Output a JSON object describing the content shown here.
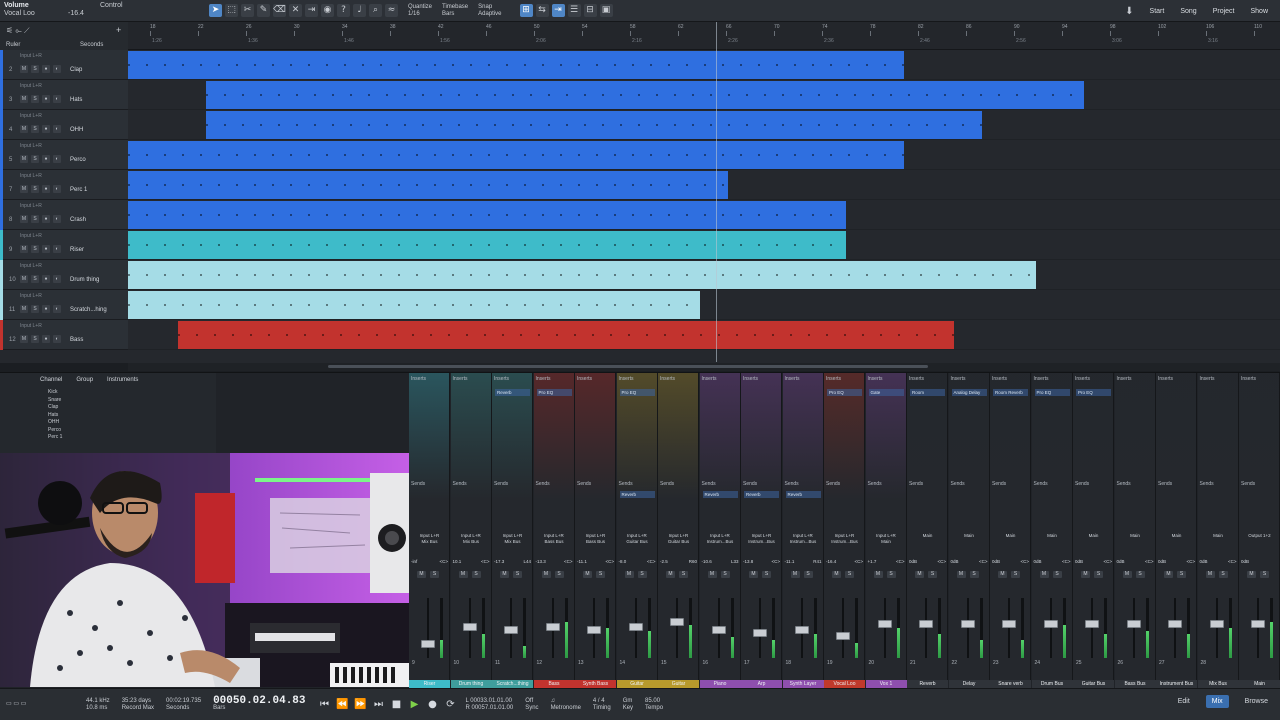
{
  "toolbar": {
    "inspector_param": "Volume",
    "inspector_track": "Vocal Loo",
    "inspector_value": "-16.4",
    "inspector_control": "Control",
    "quantize_label": "Quantize",
    "quantize_value": "1/16",
    "timebase_label": "Timebase",
    "timebase_value": "Bars",
    "snap_label": "Snap",
    "snap_value": "Adaptive",
    "start": "Start",
    "song": "Song",
    "project": "Project",
    "show": "Show"
  },
  "ruler": {
    "ruler_label": "Ruler",
    "seconds_label": "Seconds",
    "bar_ticks": [
      "18",
      "22",
      "26",
      "30",
      "34",
      "38",
      "42",
      "46",
      "50",
      "54",
      "58",
      "62",
      "66",
      "70",
      "74",
      "78",
      "82",
      "86",
      "90",
      "94",
      "98",
      "102",
      "106",
      "110"
    ],
    "time_ticks": [
      "1:26",
      "1:36",
      "1:46",
      "1:56",
      "2:06",
      "2:16",
      "2:26",
      "2:36",
      "2:46",
      "2:56",
      "3:06",
      "3:16"
    ]
  },
  "tracks": [
    {
      "num": "2",
      "name": "Clap",
      "input": "Input L+R",
      "color": "#2f6fe0"
    },
    {
      "num": "3",
      "name": "Hats",
      "input": "Input L+R",
      "color": "#2f6fe0"
    },
    {
      "num": "4",
      "name": "OHH",
      "input": "Input L+R",
      "color": "#2f6fe0"
    },
    {
      "num": "5",
      "name": "Perco",
      "input": "Input L+R",
      "color": "#2f6fe0"
    },
    {
      "num": "7",
      "name": "Perc 1",
      "input": "Input L+R",
      "color": "#2f6fe0"
    },
    {
      "num": "8",
      "name": "Crash",
      "input": "Input L+R",
      "color": "#2f6fe0"
    },
    {
      "num": "9",
      "name": "Riser",
      "input": "Input L+R",
      "color": "#3ebbc9"
    },
    {
      "num": "10",
      "name": "Drum thing",
      "input": "Input L+R",
      "color": "#a5dce6"
    },
    {
      "num": "11",
      "name": "Scratch...hing",
      "input": "Input L+R",
      "color": "#a5dce6"
    },
    {
      "num": "12",
      "name": "Bass",
      "input": "Input L+R",
      "color": "#c2332e"
    }
  ],
  "mixer": {
    "tabs": [
      "Channel",
      "Group",
      "Instruments"
    ],
    "list": [
      "Kick",
      "Snare",
      "Clap",
      "Hats",
      "OHH",
      "Perco",
      "Perc 1"
    ],
    "inserts_label": "Inserts",
    "sends_label": "Sends",
    "strips": [
      {
        "num": "9",
        "name": "Riser",
        "io": "Input L+R",
        "bus": "Mix Bus",
        "vol": "-inf",
        "pan": "<C>",
        "color": "#3ebbc9",
        "insert": "",
        "send": "",
        "level": 0.25,
        "meter": 0.3
      },
      {
        "num": "10",
        "name": "Drum thing",
        "io": "Input L+R",
        "bus": "Mix Bus",
        "vol": "10.1",
        "pan": "<C>",
        "color": "#3f9e9d",
        "insert": "",
        "send": "",
        "level": 0.55,
        "meter": 0.4
      },
      {
        "num": "11",
        "name": "Scratch...thing",
        "io": "Input L+R",
        "bus": "Mix Bus",
        "vol": "-17.3",
        "pan": "L44",
        "color": "#3f9e9d",
        "insert": "Reverb",
        "send": "",
        "level": 0.5,
        "meter": 0.2
      },
      {
        "num": "12",
        "name": "Bass",
        "io": "Input L+R",
        "bus": "Bass Bus",
        "vol": "-13.3",
        "pan": "<C>",
        "color": "#c2332e",
        "insert": "Pro EQ",
        "send": "",
        "level": 0.55,
        "meter": 0.6
      },
      {
        "num": "13",
        "name": "Synth Bass",
        "io": "Input L+R",
        "bus": "Bass Bus",
        "vol": "-11.1",
        "pan": "<C>",
        "color": "#c2332e",
        "insert": "",
        "send": "",
        "level": 0.5,
        "meter": 0.5
      },
      {
        "num": "14",
        "name": "Guitar",
        "io": "Input L+R",
        "bus": "Guitar Bus",
        "vol": "-8.0",
        "pan": "<C>",
        "color": "#b89a2c",
        "insert": "Pro EQ",
        "send": "Reverb",
        "level": 0.55,
        "meter": 0.45
      },
      {
        "num": "15",
        "name": "Guitar",
        "io": "Input L+R",
        "bus": "Guitar Bus",
        "vol": "-2.5",
        "pan": "R60",
        "color": "#b89a2c",
        "insert": "",
        "send": "",
        "level": 0.65,
        "meter": 0.55
      },
      {
        "num": "16",
        "name": "Piano",
        "io": "Input L+R",
        "bus": "Instrum...Bus",
        "vol": "-10.6",
        "pan": "L33",
        "color": "#8e4fae",
        "insert": "",
        "send": "Reverb",
        "level": 0.5,
        "meter": 0.35
      },
      {
        "num": "17",
        "name": "Arp",
        "io": "Input L+R",
        "bus": "Instrum...Bus",
        "vol": "-13.8",
        "pan": "<C>",
        "color": "#8e4fae",
        "insert": "",
        "send": "Reverb",
        "level": 0.45,
        "meter": 0.3
      },
      {
        "num": "18",
        "name": "Synth Layer",
        "io": "Input L+R",
        "bus": "Instrum...Bus",
        "vol": "-11.1",
        "pan": "R41",
        "color": "#8e4fae",
        "insert": "",
        "send": "Reverb",
        "level": 0.5,
        "meter": 0.4
      },
      {
        "num": "19",
        "name": "Vocal Loo",
        "io": "Input L+R",
        "bus": "Instrum...Bus",
        "vol": "-16.4",
        "pan": "<C>",
        "color": "#c0392b",
        "insert": "Pro EQ",
        "send": "",
        "level": 0.4,
        "meter": 0.25
      },
      {
        "num": "20",
        "name": "Vox 1",
        "io": "Input L+R",
        "bus": "Main",
        "vol": "+1.7",
        "pan": "<C>",
        "color": "#8e4fae",
        "insert": "Gate",
        "send": "",
        "level": 0.6,
        "meter": 0.5
      },
      {
        "num": "21",
        "name": "Reverb",
        "io": "",
        "bus": "Main",
        "vol": "0dB",
        "pan": "<C>",
        "color": "#2c3036",
        "insert": "Room",
        "send": "",
        "level": 0.6,
        "meter": 0.4
      },
      {
        "num": "22",
        "name": "Delay",
        "io": "",
        "bus": "Main",
        "vol": "0dB",
        "pan": "<C>",
        "color": "#2c3036",
        "insert": "Analog Delay",
        "send": "",
        "level": 0.6,
        "meter": 0.3
      },
      {
        "num": "23",
        "name": "Snare verb",
        "io": "",
        "bus": "Main",
        "vol": "0dB",
        "pan": "<C>",
        "color": "#2c3036",
        "insert": "Room Reverb",
        "send": "",
        "level": 0.6,
        "meter": 0.3
      },
      {
        "num": "24",
        "name": "Drum Bus",
        "io": "",
        "bus": "Main",
        "vol": "0dB",
        "pan": "<C>",
        "color": "#2c3036",
        "insert": "Pro EQ",
        "send": "",
        "level": 0.6,
        "meter": 0.55
      },
      {
        "num": "25",
        "name": "Guitar Bus",
        "io": "",
        "bus": "Main",
        "vol": "0dB",
        "pan": "<C>",
        "color": "#2c3036",
        "insert": "Pro EQ",
        "send": "",
        "level": 0.6,
        "meter": 0.4
      },
      {
        "num": "26",
        "name": "Bass Bus",
        "io": "",
        "bus": "Main",
        "vol": "0dB",
        "pan": "<C>",
        "color": "#2c3036",
        "insert": "",
        "send": "",
        "level": 0.6,
        "meter": 0.45
      },
      {
        "num": "27",
        "name": "Instrument Bus",
        "io": "",
        "bus": "Main",
        "vol": "0dB",
        "pan": "<C>",
        "color": "#2c3036",
        "insert": "",
        "send": "",
        "level": 0.6,
        "meter": 0.4
      },
      {
        "num": "28",
        "name": "Mix Bus",
        "io": "",
        "bus": "Main",
        "vol": "0dB",
        "pan": "<C>",
        "color": "#2c3036",
        "insert": "",
        "send": "",
        "level": 0.6,
        "meter": 0.5
      },
      {
        "num": "",
        "name": "Main",
        "io": "Output 1+2",
        "bus": "",
        "vol": "0dB",
        "pan": "",
        "color": "#2c3036",
        "insert": "",
        "send": "",
        "level": 0.6,
        "meter": 0.6
      }
    ]
  },
  "transport": {
    "sample_rate": "44.1 kHz",
    "latency": "10.8 ms",
    "record_days": "35:23 days",
    "record_max": "Record Max",
    "time_seconds": "00:02:19.735",
    "seconds_label": "Seconds",
    "position": "00050.02.04.83",
    "bars_label": "Bars",
    "loop_start": "L 00033.01.01.00",
    "loop_end": "R 00057.01.01.00",
    "sync": "Off",
    "sync_label": "Sync",
    "metronome_label": "Metronome",
    "signature": "4 / 4",
    "timing_label": "Timing",
    "key": "Gm",
    "key_label": "Key",
    "tempo": "85.00",
    "tempo_label": "Tempo",
    "edit": "Edit",
    "mix": "Mix",
    "browse": "Browse"
  }
}
